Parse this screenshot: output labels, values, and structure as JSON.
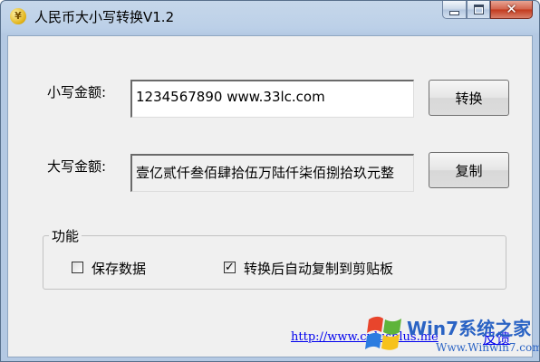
{
  "window": {
    "title": "人民币大小写转换V1.2",
    "app_icon_glyph": "¥",
    "close_glyph": "✕"
  },
  "form": {
    "lower_label": "小写金额:",
    "lower_value": "1234567890 www.33lc.com",
    "upper_label": "大写金额:",
    "upper_value": "壹亿贰仟叁佰肆拾伍万陆仟柒佰捌拾玖元整",
    "convert_button": "转换",
    "copy_button": "复制"
  },
  "functions": {
    "group_title": "功能",
    "save_data": {
      "label": "保存数据",
      "checked": false
    },
    "auto_copy": {
      "label": "转换后自动复制到剪贴板",
      "checked": true,
      "mark": "✓"
    }
  },
  "footer": {
    "link_text": "http://www.cplusplus.me",
    "feedback_text": "反馈"
  },
  "watermark": {
    "main_text": "Win7系统之家",
    "sub_text": "Www.Winwin7.com"
  },
  "colors": {
    "title_bar": "#bcd0e8",
    "close_button": "#c2391c",
    "link": "#0000ee",
    "watermark": "#2a63c4"
  }
}
